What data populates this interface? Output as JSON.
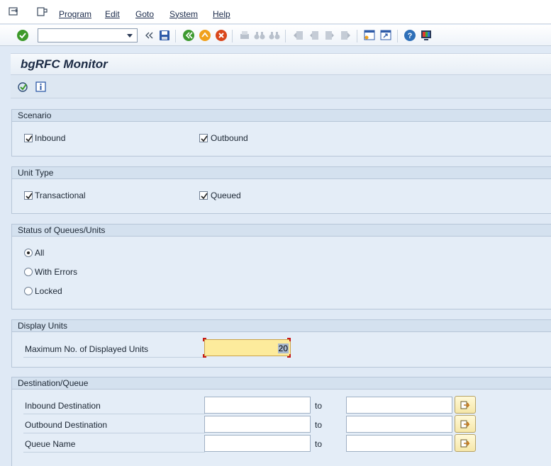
{
  "menubar": {
    "items": [
      {
        "label": "Program"
      },
      {
        "label": "Edit"
      },
      {
        "label": "Goto"
      },
      {
        "label": "System"
      },
      {
        "label": "Help"
      }
    ]
  },
  "toolbar": {
    "command_field_value": "",
    "icons": [
      "enter-check-icon",
      "command-dropdown-icon",
      "collapse-icon",
      "save-icon",
      "back-icon",
      "exit-icon",
      "cancel-icon",
      "print-icon",
      "find-icon",
      "find-next-icon",
      "first-page-icon",
      "previous-page-icon",
      "next-page-icon",
      "last-page-icon",
      "create-session-icon",
      "shortcut-icon",
      "help-icon",
      "customize-layout-icon"
    ]
  },
  "title": "bgRFC Monitor",
  "app_toolbar": {
    "icons": [
      "execute-icon",
      "info-icon"
    ]
  },
  "scenario": {
    "header": "Scenario",
    "inbound": {
      "label": "Inbound",
      "checked": true
    },
    "outbound": {
      "label": "Outbound",
      "checked": true
    }
  },
  "unit_type": {
    "header": "Unit Type",
    "transactional": {
      "label": "Transactional",
      "checked": true
    },
    "queued": {
      "label": "Queued",
      "checked": true
    }
  },
  "status": {
    "header": "Status of Queues/Units",
    "options": [
      {
        "label": "All",
        "selected": true
      },
      {
        "label": "With Errors",
        "selected": false
      },
      {
        "label": "Locked",
        "selected": false
      }
    ]
  },
  "display_units": {
    "header": "Display Units",
    "max_label": "Maximum No. of Displayed Units",
    "max_value": "20"
  },
  "destination": {
    "header": "Destination/Queue",
    "to_label": "to",
    "rows": [
      {
        "label": "Inbound Destination",
        "from": "",
        "to": ""
      },
      {
        "label": "Outbound Destination",
        "from": "",
        "to": ""
      },
      {
        "label": "Queue Name",
        "from": "",
        "to": ""
      }
    ]
  },
  "colors": {
    "background": "#dfe9f5",
    "highlight_field": "#fdeb9c",
    "group_header": "#d4e1ef"
  }
}
